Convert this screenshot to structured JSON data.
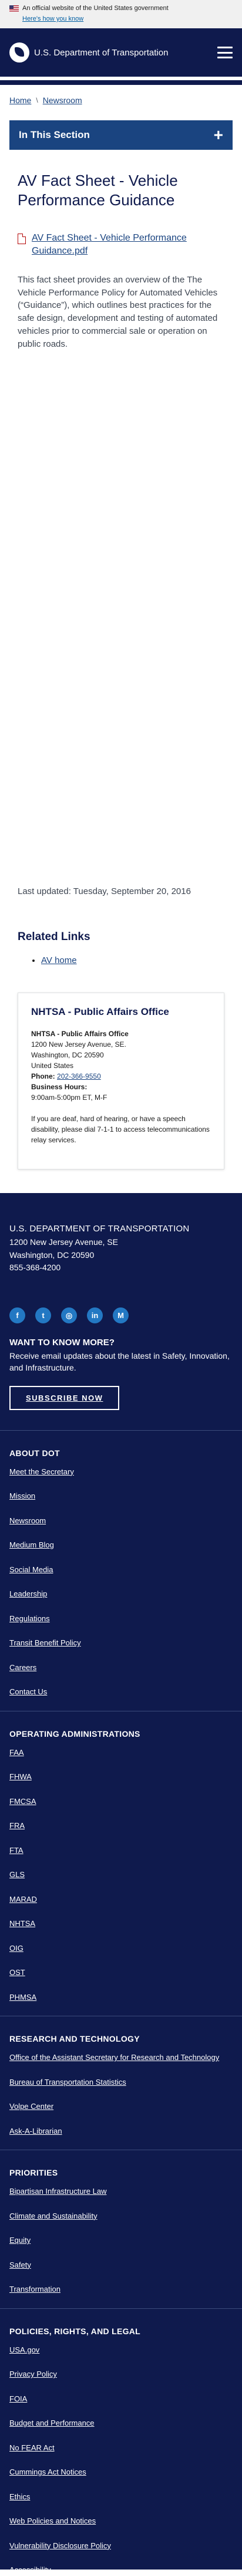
{
  "gov_banner": {
    "text": "An official website of the United States government",
    "how_link": "Here's how you know"
  },
  "header": {
    "site_name": "U.S. Department of Transportation"
  },
  "breadcrumb": [
    "Home",
    "Newsroom"
  ],
  "section_toggle": {
    "label": "In This Section",
    "icon": "+"
  },
  "page": {
    "title": "AV Fact Sheet - Vehicle Performance Guidance",
    "attachment": "AV Fact Sheet - Vehicle Performance Guidance.pdf",
    "body": "This fact sheet provides an overview of the The Vehicle Performance Policy for Automated Vehicles (“Guidance”), which outlines best practices for the safe design, development and testing of automated vehicles prior to commercial sale or operation on public roads.",
    "last_updated": "Last updated: Tuesday, September 20, 2016"
  },
  "related": {
    "heading": "Related Links",
    "links": [
      "AV home"
    ]
  },
  "contact": {
    "heading": "NHTSA - Public Affairs Office",
    "name": "NHTSA - Public Affairs Office",
    "street": "1200 New Jersey Avenue, SE.",
    "city": "Washington, DC 20590",
    "country": "United States",
    "phone_label": "Phone:",
    "phone": "202-366-9550",
    "hours_label": "Business Hours:",
    "hours": "9:00am-5:00pm ET, M-F",
    "note": "If you are deaf, hard of hearing, or have a speech disability, please dial 7-1-1 to access telecommunications relay services."
  },
  "footer": {
    "org": "U.S. DEPARTMENT OF TRANSPORTATION",
    "address1": "1200 New Jersey Avenue, SE",
    "address2": "Washington, DC 20590",
    "phone": "855-368-4200",
    "socials": [
      {
        "icon": "facebook-icon",
        "glyph": "f"
      },
      {
        "icon": "twitter-icon",
        "glyph": "t"
      },
      {
        "icon": "instagram-icon",
        "glyph": "◎"
      },
      {
        "icon": "linkedin-icon",
        "glyph": "in"
      },
      {
        "icon": "medium-icon",
        "glyph": "M"
      }
    ],
    "want_heading": "WANT TO KNOW MORE?",
    "want_text": "Receive email updates about the latest in Safety, Innovation, and Infrastructure.",
    "subscribe": "SUBSCRIBE NOW",
    "sections": [
      {
        "title": "ABOUT DOT",
        "links": [
          "Meet the Secretary",
          "Mission",
          "Newsroom",
          "Medium Blog",
          "Social Media",
          "Leadership",
          "Regulations",
          "Transit Benefit Policy",
          "Careers",
          "Contact Us"
        ]
      },
      {
        "title": "OPERATING ADMINISTRATIONS",
        "links": [
          "FAA",
          "FHWA",
          "FMCSA",
          "FRA",
          "FTA",
          "GLS",
          "MARAD",
          "NHTSA",
          "OIG",
          "OST",
          "PHMSA"
        ]
      },
      {
        "title": "RESEARCH AND TECHNOLOGY",
        "links": [
          "Office of the Assistant Secretary for Research and Technology",
          "Bureau of Transportation Statistics",
          "Volpe Center",
          "Ask-A-Librarian"
        ]
      },
      {
        "title": "PRIORITIES",
        "links": [
          "Bipartisan Infrastructure Law",
          "Climate and Sustainability",
          "Equity",
          "Safety",
          "Transformation"
        ]
      },
      {
        "title": "POLICIES, RIGHTS, AND LEGAL",
        "links": [
          "USA.gov",
          "Privacy Policy",
          "FOIA",
          "Budget and Performance",
          "No FEAR Act",
          "Cummings Act Notices",
          "Ethics",
          "Web Policies and Notices",
          "Vulnerability Disclosure Policy",
          "Accessibility"
        ]
      }
    ]
  }
}
